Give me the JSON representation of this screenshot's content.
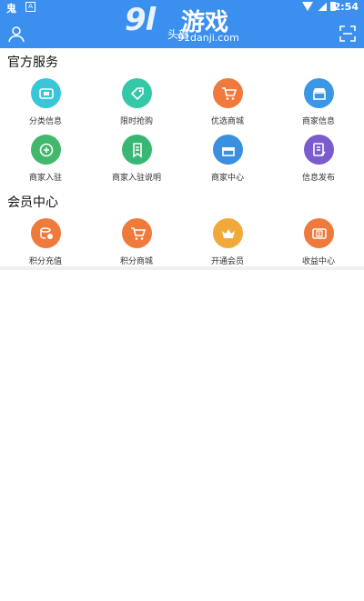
{
  "status": {
    "left_glyph": "鬼",
    "left_badge": "A",
    "time": "2:54"
  },
  "header": {
    "title": "头部",
    "watermark_big": "9l",
    "watermark_cn": "游戏",
    "watermark_url": "91danji.com"
  },
  "sections": [
    {
      "title": "官方服务",
      "items": [
        {
          "label": "分类信息",
          "color": "#38c6d8"
        },
        {
          "label": "限时抢购",
          "color": "#33c8a8"
        },
        {
          "label": "优选商城",
          "color": "#f07a3c"
        },
        {
          "label": "商家信息",
          "color": "#3b97e6"
        },
        {
          "label": "商家入驻",
          "color": "#41b86b"
        },
        {
          "label": "商家入驻说明",
          "color": "#37b772"
        },
        {
          "label": "商家中心",
          "color": "#3b8fe0"
        },
        {
          "label": "信息发布",
          "color": "#7a5ccf"
        }
      ]
    },
    {
      "title": "会员中心",
      "items": [
        {
          "label": "积分充值",
          "color": "#f07a3c"
        },
        {
          "label": "积分商城",
          "color": "#f07a3c"
        },
        {
          "label": "开通会员",
          "color": "#f1a93a"
        },
        {
          "label": "收益中心",
          "color": "#f07a3c"
        }
      ]
    }
  ]
}
